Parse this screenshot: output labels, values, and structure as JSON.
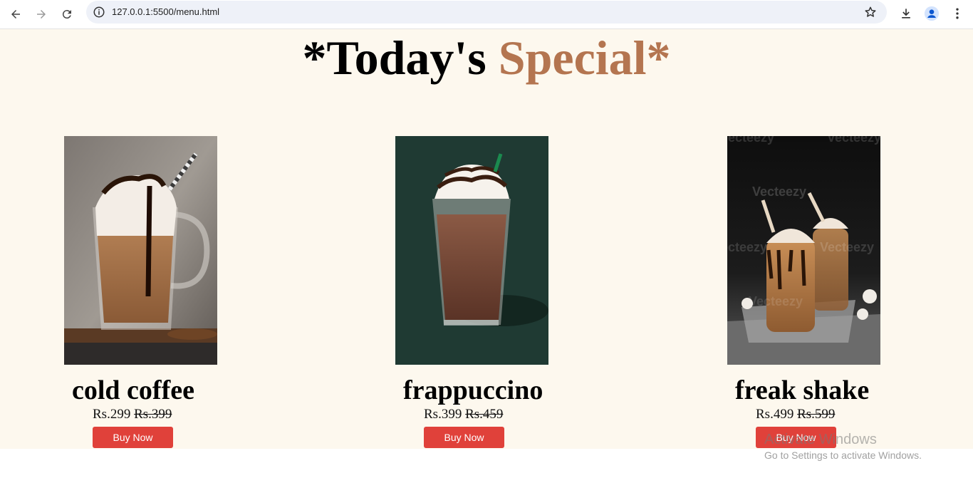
{
  "browser": {
    "url": "127.0.0.1:5500/menu.html",
    "icons": [
      "back-arrow-icon",
      "forward-arrow-icon",
      "reload-icon",
      "site-info-icon",
      "bookmark-star-icon",
      "download-icon",
      "profile-icon",
      "more-menu-icon"
    ]
  },
  "page": {
    "title_prefix": "*Today's ",
    "title_accent": "Special*",
    "accent_color": "#b47550",
    "background_color": "#fdf8ee",
    "button_color": "#e0413a"
  },
  "items": [
    {
      "name": "cold coffee",
      "price": "Rs.299",
      "old_price": "Rs.399",
      "button": "Buy Now"
    },
    {
      "name": "frappuccino",
      "price": "Rs.399",
      "old_price": "Rs.459",
      "button": "Buy Now"
    },
    {
      "name": "freak shake",
      "price": "Rs.499",
      "old_price": "Rs.599",
      "button": "Buy Now"
    }
  ],
  "image_watermark": "Vecteezy",
  "os_watermark": {
    "line1": "Activate Windows",
    "line2": "Go to Settings to activate Windows."
  }
}
